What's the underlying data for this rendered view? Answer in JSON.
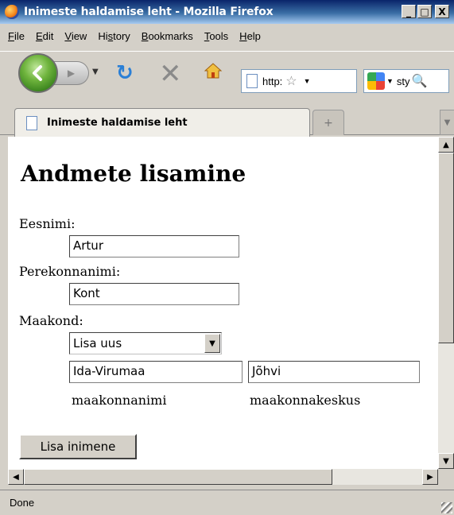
{
  "window": {
    "title": "Inimeste haldamise leht - Mozilla Firefox",
    "min_label": "_",
    "max_label": "□",
    "close_label": "X"
  },
  "menu": [
    {
      "label": "File",
      "ul": "F",
      "rest": "ile"
    },
    {
      "label": "Edit",
      "ul": "E",
      "rest": "dit"
    },
    {
      "label": "View",
      "ul": "V",
      "rest": "iew"
    },
    {
      "label": "History",
      "pre": "Hi",
      "ul": "s",
      "rest": "tory"
    },
    {
      "label": "Bookmarks",
      "ul": "B",
      "rest": "ookmarks"
    },
    {
      "label": "Tools",
      "ul": "T",
      "rest": "ools"
    },
    {
      "label": "Help",
      "ul": "H",
      "rest": "elp"
    }
  ],
  "toolbar": {
    "url": "http:",
    "search": "sty"
  },
  "tab": {
    "title": "Inimeste haldamise leht",
    "new_tab": "+"
  },
  "form": {
    "heading": "Andmete lisamine",
    "firstname_label": "Eesnimi:",
    "firstname_value": "Artur",
    "lastname_label": "Perekonnanimi:",
    "lastname_value": "Kont",
    "county_label": "Maakond:",
    "county_selected": "Lisa uus",
    "county_name_value": "Ida-Virumaa",
    "county_center_value": "Jõhvi",
    "county_name_caption": "maakonnanimi",
    "county_center_caption": "maakonnakeskus",
    "submit_label": "Lisa inimene"
  },
  "status": {
    "text": "Done"
  },
  "colors": {
    "titlebar": "#0a246a",
    "chrome": "#d4d0c8",
    "back_button": "#6fb43d",
    "reload": "#2a7fd6"
  }
}
